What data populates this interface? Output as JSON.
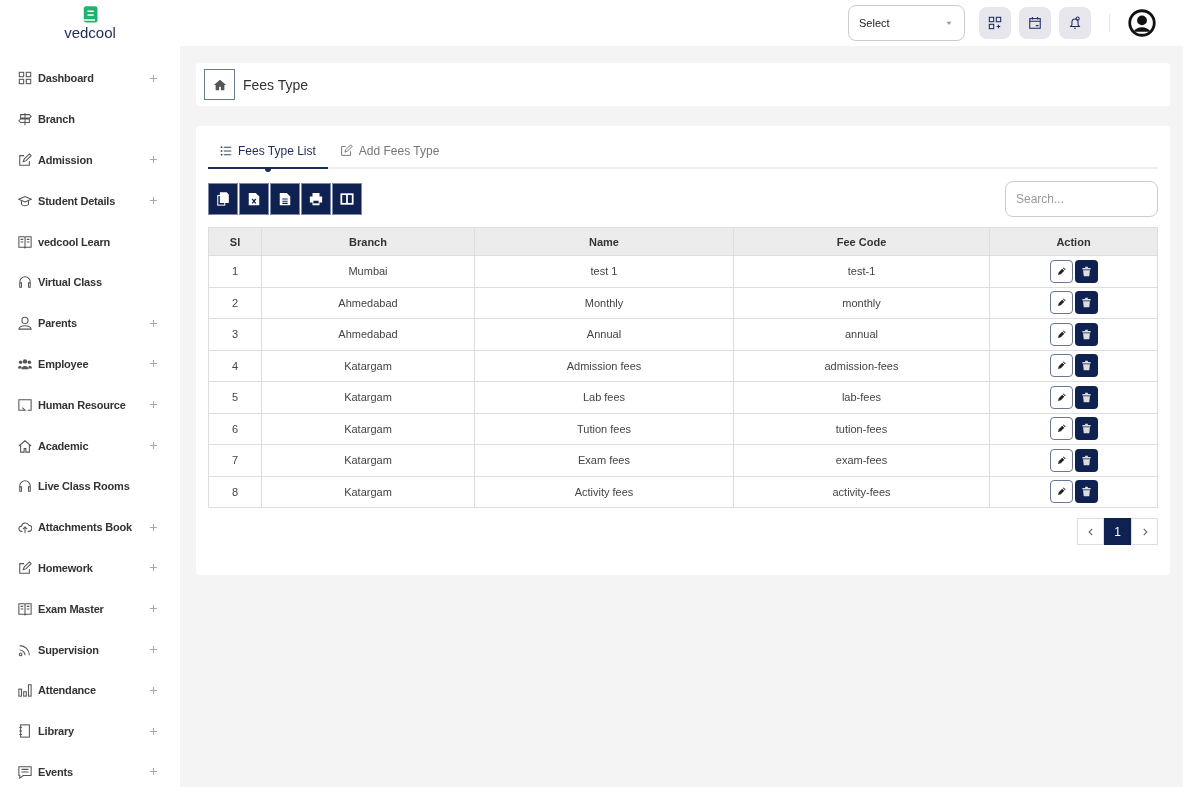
{
  "logo": {
    "text": "vedcool"
  },
  "header": {
    "select": {
      "placeholder": "Select"
    }
  },
  "sidebar": {
    "items": [
      {
        "label": "Dashboard",
        "expandable": true
      },
      {
        "label": "Branch",
        "expandable": false
      },
      {
        "label": "Admission",
        "expandable": true
      },
      {
        "label": "Student Details",
        "expandable": true
      },
      {
        "label": "vedcool Learn",
        "expandable": false
      },
      {
        "label": "Virtual Class",
        "expandable": false
      },
      {
        "label": "Parents",
        "expandable": true
      },
      {
        "label": "Employee",
        "expandable": true
      },
      {
        "label": "Human Resource",
        "expandable": true
      },
      {
        "label": "Academic",
        "expandable": true
      },
      {
        "label": "Live Class Rooms",
        "expandable": false
      },
      {
        "label": "Attachments Book",
        "expandable": true
      },
      {
        "label": "Homework",
        "expandable": true
      },
      {
        "label": "Exam Master",
        "expandable": true
      },
      {
        "label": "Supervision",
        "expandable": true
      },
      {
        "label": "Attendance",
        "expandable": true
      },
      {
        "label": "Library",
        "expandable": true
      },
      {
        "label": "Events",
        "expandable": true
      }
    ]
  },
  "breadcrumb": {
    "title": "Fees Type"
  },
  "tabs": [
    {
      "label": "Fees Type List",
      "selected": true
    },
    {
      "label": "Add Fees Type",
      "selected": false
    }
  ],
  "search": {
    "placeholder": "Search..."
  },
  "table": {
    "columns": [
      "Sl",
      "Branch",
      "Name",
      "Fee Code",
      "Action"
    ],
    "rows": [
      [
        "1",
        "Mumbai",
        "test 1",
        "test-1"
      ],
      [
        "2",
        "Ahmedabad",
        "Monthly",
        "monthly"
      ],
      [
        "3",
        "Ahmedabad",
        "Annual",
        "annual"
      ],
      [
        "4",
        "Katargam",
        "Admission fees",
        "admission-fees"
      ],
      [
        "5",
        "Katargam",
        "Lab fees",
        "lab-fees"
      ],
      [
        "6",
        "Katargam",
        "Tution fees",
        "tution-fees"
      ],
      [
        "7",
        "Katargam",
        "Exam fees",
        "exam-fees"
      ],
      [
        "8",
        "Katargam",
        "Activity fees",
        "activity-fees"
      ]
    ]
  },
  "pagination": {
    "pages": [
      {
        "label": "1",
        "selected": true
      }
    ]
  }
}
